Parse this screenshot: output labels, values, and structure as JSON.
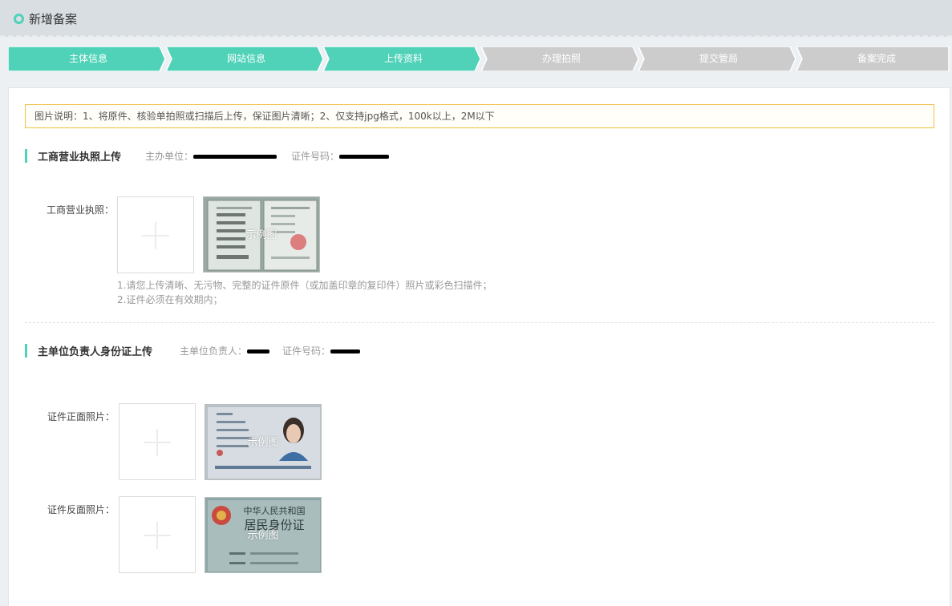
{
  "header": {
    "title": "新增备案"
  },
  "steps": [
    {
      "label": "主体信息",
      "state": "done"
    },
    {
      "label": "网站信息",
      "state": "done"
    },
    {
      "label": "上传资料",
      "state": "active"
    },
    {
      "label": "办理拍照",
      "state": "pending"
    },
    {
      "label": "提交管局",
      "state": "pending"
    },
    {
      "label": "备案完成",
      "state": "pending"
    }
  ],
  "colors": {
    "accent": "#4fd2b8",
    "pending": "#cccccc",
    "notice_border": "#f0c043"
  },
  "notice": {
    "text": "图片说明：1、将原件、核验单拍照或扫描后上传，保证图片清晰；2、仅支持jpg格式，100k以上，2M以下"
  },
  "section1": {
    "title": "工商营业执照上传",
    "org_label": "主办单位：",
    "cert_label": "证件号码：",
    "field_label": "工商营业执照：",
    "sample_caption": "示例图",
    "hint1": "1.请您上传清晰、无污物、完整的证件原件（或加盖印章的复印件）照片或彩色扫描件；",
    "hint2": "2.证件必须在有效期内；"
  },
  "section2": {
    "title": "主单位负责人身份证上传",
    "owner_label": "主单位负责人：",
    "cert_label": "证件号码：",
    "front_label": "证件正面照片：",
    "back_label": "证件反面照片：",
    "sample_caption": "示例图",
    "id_back_line1": "中华人民共和国",
    "id_back_line2": "居民身份证"
  },
  "icons": {
    "header": "ring-icon",
    "upload": "plus-icon"
  }
}
